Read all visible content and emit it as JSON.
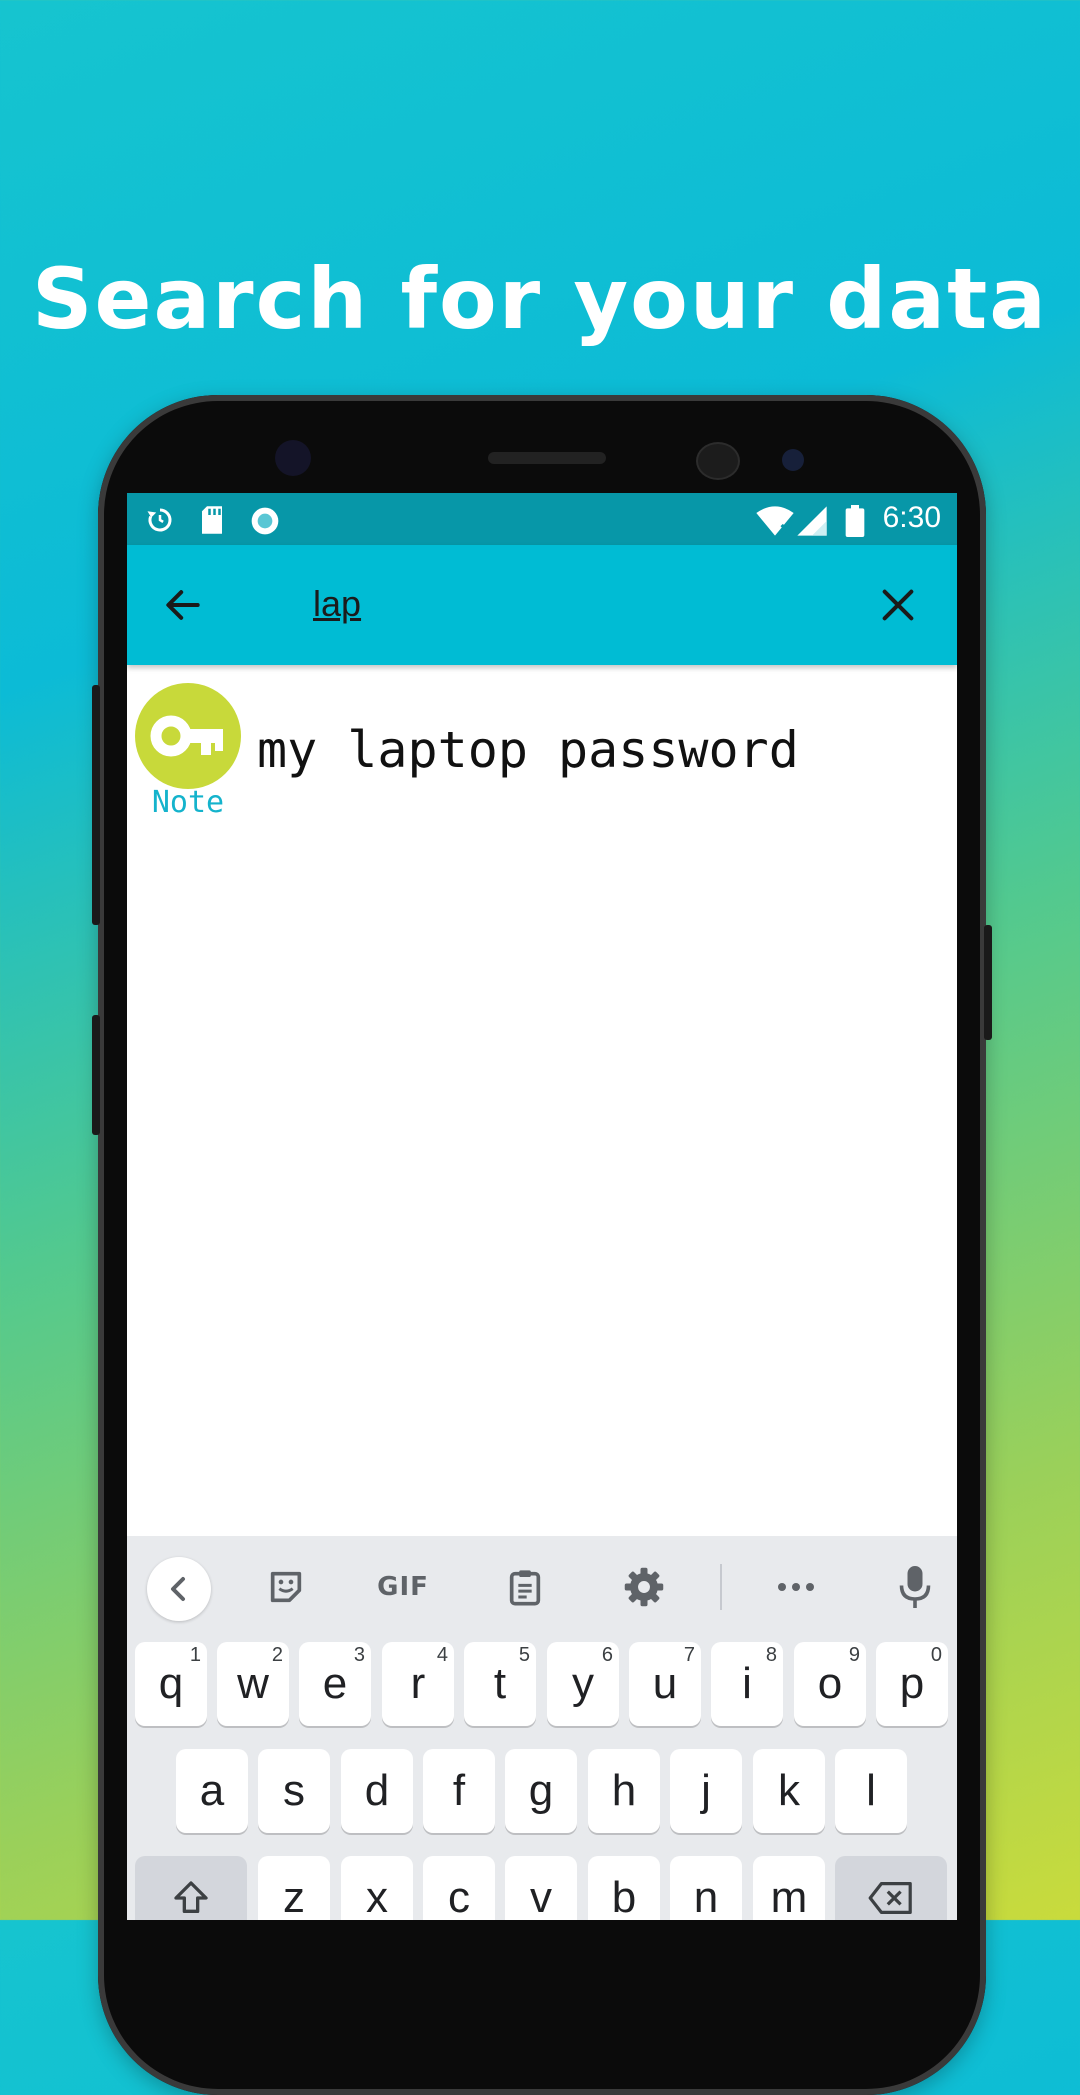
{
  "headline": "Search for your data",
  "statusbar": {
    "time": "6:30",
    "left_icons": [
      "sync-icon",
      "sd-card-icon",
      "record-icon"
    ],
    "right_icons": [
      "wifi-icon",
      "signal-icon",
      "battery-icon"
    ]
  },
  "appbar": {
    "query": "lap",
    "back_icon": "arrow-back-icon",
    "clear_icon": "close-icon"
  },
  "results": [
    {
      "icon": "key-icon",
      "type_label": "Note",
      "title": "my laptop password"
    }
  ],
  "keyboard": {
    "toolbar": [
      "chevron-left-icon",
      "sticker-icon",
      "GIF",
      "clipboard-icon",
      "gear-icon",
      "more-icon",
      "mic-icon"
    ],
    "gif_label": "GIF",
    "row1": [
      {
        "k": "q",
        "h": "1"
      },
      {
        "k": "w",
        "h": "2"
      },
      {
        "k": "e",
        "h": "3"
      },
      {
        "k": "r",
        "h": "4"
      },
      {
        "k": "t",
        "h": "5"
      },
      {
        "k": "y",
        "h": "6"
      },
      {
        "k": "u",
        "h": "7"
      },
      {
        "k": "i",
        "h": "8"
      },
      {
        "k": "o",
        "h": "9"
      },
      {
        "k": "p",
        "h": "0"
      }
    ],
    "row2": [
      "a",
      "s",
      "d",
      "f",
      "g",
      "h",
      "j",
      "k",
      "l"
    ],
    "row3": [
      "z",
      "x",
      "c",
      "v",
      "b",
      "n",
      "m"
    ]
  },
  "colors": {
    "appbar": "#00bcd4",
    "statusbar": "#0797a8",
    "avatar": "#c8d93a",
    "note_label": "#14b3cc"
  }
}
